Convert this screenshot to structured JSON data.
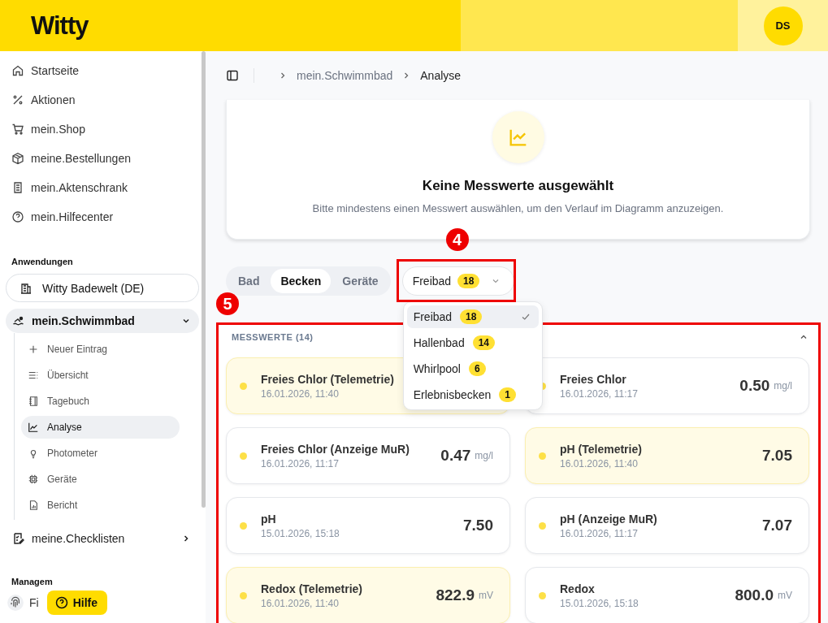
{
  "header": {
    "logo": "Witty",
    "avatar": "DS"
  },
  "sidebar": {
    "items": [
      {
        "label": "Startseite"
      },
      {
        "label": "Aktionen"
      },
      {
        "label": "mein.Shop"
      },
      {
        "label": "meine.Bestellungen"
      },
      {
        "label": "mein.Aktenschrank"
      },
      {
        "label": "mein.Hilfecenter"
      }
    ],
    "section": "Anwendungen",
    "app": "Witty Badewelt (DE)",
    "groups": [
      {
        "label": "mein.Schwimmbad",
        "expanded": true,
        "children": [
          {
            "label": "Neuer Eintrag",
            "selected": false
          },
          {
            "label": "Übersicht",
            "selected": false
          },
          {
            "label": "Tagebuch",
            "selected": false
          },
          {
            "label": "Analyse",
            "selected": true
          },
          {
            "label": "Photometer",
            "selected": false
          },
          {
            "label": "Geräte",
            "selected": false
          },
          {
            "label": "Bericht",
            "selected": false
          }
        ]
      },
      {
        "label": "meine.Checklisten",
        "expanded": false
      }
    ],
    "section_2": "Managem",
    "last_item": "Fi"
  },
  "help_button": "Hilfe",
  "breadcrumb": [
    "mein.Schwimmbad",
    "Analyse"
  ],
  "empty_state": {
    "title": "Keine Messwerte ausgewählt",
    "text": "Bitte mindestens einen Messwert auswählen, um den Verlauf im Diagramm anzuzeigen."
  },
  "tabs": [
    {
      "label": "Bad",
      "selected": false
    },
    {
      "label": "Becken",
      "selected": true
    },
    {
      "label": "Geräte",
      "selected": false
    }
  ],
  "pool_select": {
    "value": "Freibad",
    "count": "18",
    "open": true,
    "options": [
      {
        "label": "Freibad",
        "count": "18",
        "selected": true
      },
      {
        "label": "Hallenbad",
        "count": "14",
        "selected": false
      },
      {
        "label": "Whirlpool",
        "count": "6",
        "selected": false
      },
      {
        "label": "Erlebnisbecken",
        "count": "1",
        "selected": false
      }
    ]
  },
  "measurements": {
    "title": "MESSWERTE (14)",
    "expanded": true,
    "items": [
      {
        "name": "Freies Chlor (Telemetrie)",
        "time": "16.01.2026, 11:40",
        "highlighted": true
      },
      {
        "name": "Freies Chlor",
        "time": "16.01.2026, 11:17",
        "value": "0.50",
        "unit": "mg/l",
        "highlighted": false
      },
      {
        "name": "Freies Chlor (Anzeige MuR)",
        "time": "16.01.2026, 11:17",
        "value": "0.47",
        "unit": "mg/l",
        "highlighted": false
      },
      {
        "name": "pH (Telemetrie)",
        "time": "16.01.2026, 11:40",
        "value": "7.05",
        "highlighted": true
      },
      {
        "name": "pH",
        "time": "15.01.2026, 15:18",
        "value": "7.50",
        "highlighted": false
      },
      {
        "name": "pH (Anzeige MuR)",
        "time": "16.01.2026, 11:17",
        "value": "7.07",
        "highlighted": false
      },
      {
        "name": "Redox (Telemetrie)",
        "time": "16.01.2026, 11:40",
        "value": "822.9",
        "unit": "mV",
        "highlighted": true
      },
      {
        "name": "Redox",
        "time": "15.01.2026, 15:18",
        "value": "800.0",
        "unit": "mV",
        "highlighted": false
      }
    ]
  },
  "annotations": [
    {
      "label": "4"
    },
    {
      "label": "5"
    }
  ]
}
